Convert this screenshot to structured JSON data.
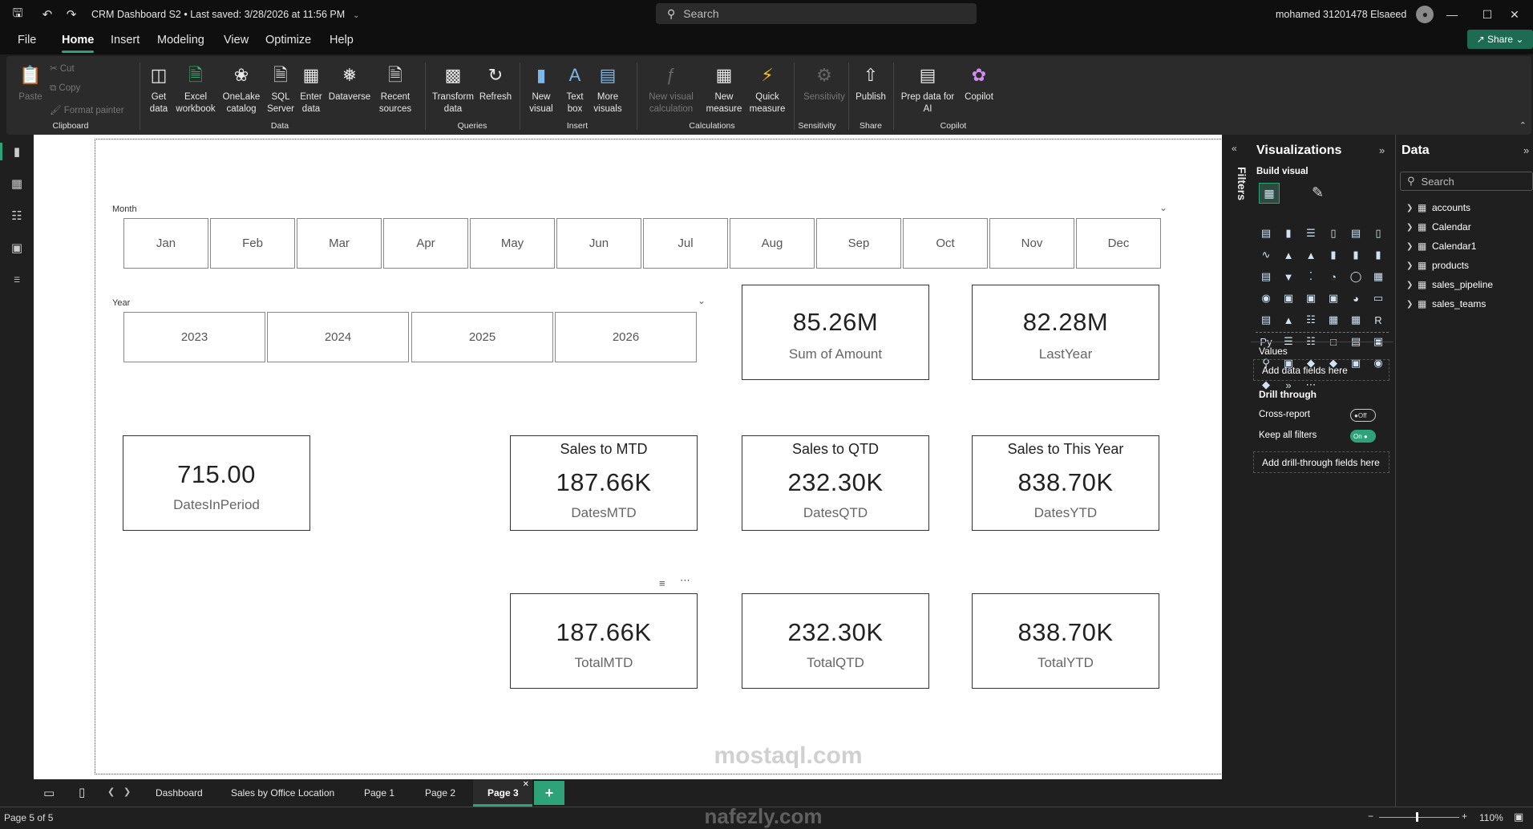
{
  "titlebar": {
    "doc_title": "CRM Dashboard S2",
    "saved": "Last saved: 3/28/2026 at 11:56 PM",
    "search_placeholder": "Search",
    "user": "mohamed 31201478 Elsaeed"
  },
  "menu": [
    "File",
    "Home",
    "Insert",
    "Modeling",
    "View",
    "Optimize",
    "Help"
  ],
  "share_label": "Share",
  "ribbon": {
    "paste": "Paste",
    "cut": "Cut",
    "copy": "Copy",
    "format_painter": "Format painter",
    "get_data": "Get data",
    "excel": "Excel workbook",
    "onelake": "OneLake catalog",
    "sql": "SQL Server",
    "enter_data": "Enter data",
    "dataverse": "Dataverse",
    "recent": "Recent sources",
    "transform": "Transform data",
    "refresh": "Refresh",
    "new_visual": "New visual",
    "text_box": "Text box",
    "more_visuals": "More visuals",
    "new_visual_calc": "New visual calculation",
    "new_measure": "New measure",
    "quick_measure": "Quick measure",
    "sensitivity": "Sensitivity",
    "publish": "Publish",
    "prep_copilot": "Prep data for AI",
    "copilot": "Copilot",
    "groups": {
      "clipboard": "Clipboard",
      "data": "Data",
      "queries": "Queries",
      "insert": "Insert",
      "calculations": "Calculations",
      "sensitivity": "Sensitivity",
      "share": "Share",
      "copilot": "Copilot"
    }
  },
  "canvas": {
    "month_label": "Month",
    "months": [
      "Jan",
      "Feb",
      "Mar",
      "Apr",
      "May",
      "Jun",
      "Jul",
      "Aug",
      "Sep",
      "Oct",
      "Nov",
      "Dec"
    ],
    "year_label": "Year",
    "years": [
      "2023",
      "2024",
      "2025",
      "2026"
    ],
    "cards": {
      "sum_amount": {
        "value": "85.26M",
        "label": "Sum of Amount"
      },
      "last_year": {
        "value": "82.28M",
        "label": "LastYear"
      },
      "dates_in_period": {
        "value": "715.00",
        "label": "DatesInPeriod"
      },
      "mtd": {
        "title": "Sales to MTD",
        "value": "187.66K",
        "label": "DatesMTD"
      },
      "qtd": {
        "title": "Sales to QTD",
        "value": "232.30K",
        "label": "DatesQTD"
      },
      "ytd": {
        "title": "Sales to This Year",
        "value": "838.70K",
        "label": "DatesYTD"
      },
      "total_mtd": {
        "value": "187.66K",
        "label": "TotalMTD"
      },
      "total_qtd": {
        "value": "232.30K",
        "label": "TotalQTD"
      },
      "total_ytd": {
        "value": "838.70K",
        "label": "TotalYTD"
      }
    }
  },
  "filters_label": "Filters",
  "visualizations": {
    "title": "Visualizations",
    "build_visual": "Build visual",
    "values_label": "Values",
    "values_drop": "Add data fields here",
    "drill_through": "Drill through",
    "cross_report": "Cross-report",
    "cross_report_state": "Off",
    "keep_filters": "Keep all filters",
    "keep_filters_state": "On",
    "drill_drop": "Add drill-through fields here"
  },
  "data_pane": {
    "title": "Data",
    "search_placeholder": "Search",
    "tables": [
      "accounts",
      "Calendar",
      "Calendar1",
      "products",
      "sales_pipeline",
      "sales_teams"
    ]
  },
  "tabs": [
    "Dashboard",
    "Sales by Office Location",
    "Page 1",
    "Page 2",
    "Page 3"
  ],
  "status": {
    "page": "Page 5 of 5",
    "zoom": "110%"
  },
  "watermark": {
    "line1": "mostaql.com",
    "line2": "nafezly.com"
  },
  "colors": {
    "accent": "#2ea37a",
    "ribbon_bg": "#2b2b2b",
    "window_bg": "#0f0f0f"
  }
}
